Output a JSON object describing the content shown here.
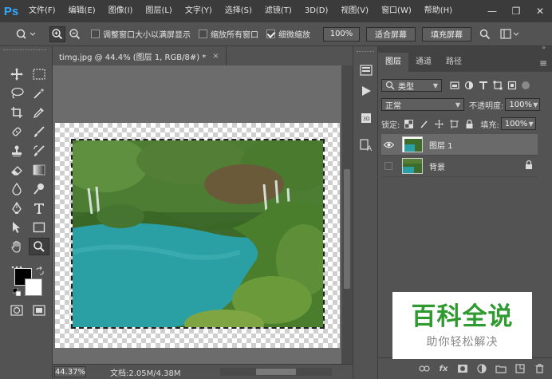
{
  "app": {
    "logo": "Ps"
  },
  "menu": [
    "文件(F)",
    "编辑(E)",
    "图像(I)",
    "图层(L)",
    "文字(Y)",
    "选择(S)",
    "滤镜(T)",
    "3D(D)",
    "视图(V)",
    "窗口(W)",
    "帮助(H)"
  ],
  "window_controls": {
    "minimize": "—",
    "restore": "❐",
    "close": "✕"
  },
  "options": {
    "resize_windows_label": "调整窗口大小以满屏显示",
    "zoom_all_label": "缩放所有窗口",
    "scrubby_zoom_label": "细微缩放",
    "zoom_value": "100%",
    "fit_screen": "适合屏幕",
    "fill_screen": "填充屏幕",
    "resize_windows_checked": false,
    "zoom_all_checked": false,
    "scrubby_zoom_checked": true
  },
  "document": {
    "tab_title": "timg.jpg @ 44.4% (图层 1, RGB/8#) *",
    "close": "×",
    "zoom": "44.37%",
    "doc_info": "文档:2.05M/4.38M"
  },
  "layers_panel": {
    "tabs": [
      "图层",
      "通道",
      "路径"
    ],
    "menu": "≡",
    "filter_kind": "类型",
    "blend_mode": "正常",
    "opacity_label": "不透明度:",
    "opacity_value": "100%",
    "lock_label": "锁定:",
    "fill_label": "填充:",
    "fill_value": "100%",
    "layers": [
      {
        "name": "图层 1",
        "visible": true,
        "active": true
      },
      {
        "name": "背景",
        "visible": false,
        "locked": true
      }
    ],
    "bottom_icons": [
      "link-icon",
      "fx-icon",
      "mask-icon",
      "adjustment-icon",
      "folder-icon",
      "new-layer-icon",
      "trash-icon"
    ]
  },
  "watermark": {
    "title": "百科全说",
    "subtitle": "助你轻松解决"
  },
  "colors": {
    "accent": "#31a8ff",
    "water": "#2aa0a5",
    "foliage": "#3c7a26",
    "watermark_green": "#2f9a2f"
  }
}
